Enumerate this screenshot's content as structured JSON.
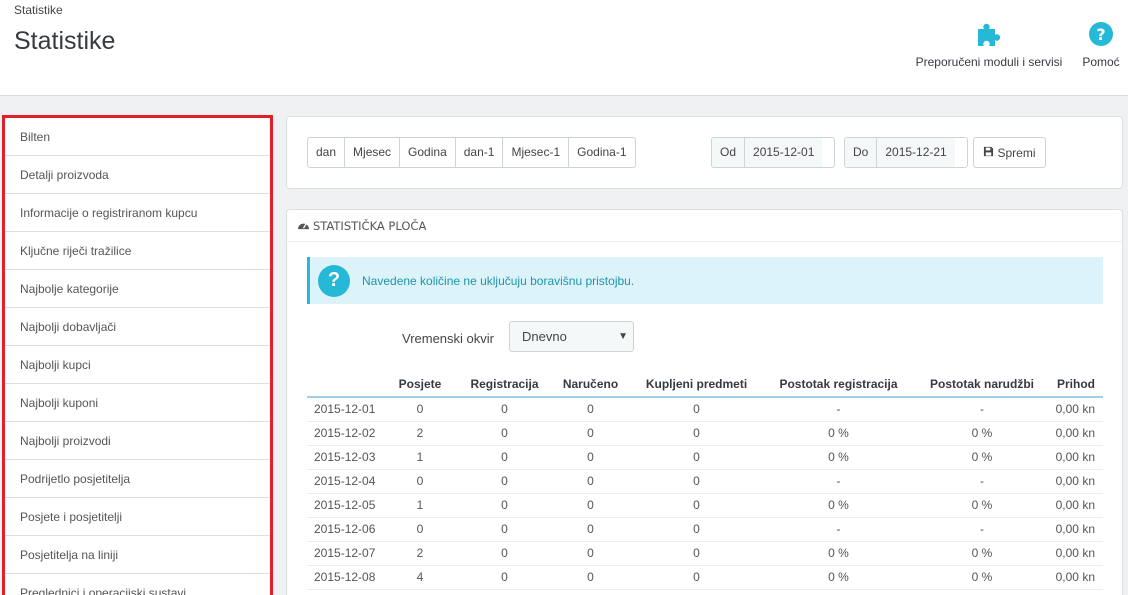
{
  "header": {
    "breadcrumb": "Statistike",
    "title": "Statistike",
    "modules_label": "Preporučeni moduli i servisi",
    "help_label": "Pomoć"
  },
  "sidebar": {
    "items": [
      "Bilten",
      "Detalji proizvoda",
      "Informacije o registriranom kupcu",
      "Ključne riječi tražilice",
      "Najbolje kategorije",
      "Najbolji dobavljači",
      "Najbolji kupci",
      "Najbolji kuponi",
      "Najbolji proizvodi",
      "Podrijetlo posjetitelja",
      "Posjete i posjetitelji",
      "Posjetitelja na liniji",
      "Preglednici i operacijski sustavi"
    ]
  },
  "date_filter": {
    "buttons": [
      "dan",
      "Mjesec",
      "Godina",
      "dan-1",
      "Mjesec-1",
      "Godina-1"
    ],
    "from_label": "Od",
    "from_value": "2015-12-01",
    "to_label": "Do",
    "to_value": "2015-12-21",
    "save_label": "Spremi"
  },
  "dashboard": {
    "heading": "STATISTIČKA PLOČA",
    "alert": "Navedene količine ne uključuju boravišnu pristojbu.",
    "timeframe_label": "Vremenski okvir",
    "timeframe_value": "Dnevno",
    "columns": [
      "",
      "Posjete",
      "Registracija",
      "Naručeno",
      "Kupljeni predmeti",
      "Postotak registracija",
      "Postotak narudžbi",
      "Prihod"
    ],
    "rows": [
      [
        "2015-12-01",
        "0",
        "0",
        "0",
        "0",
        "-",
        "-",
        "0,00 kn"
      ],
      [
        "2015-12-02",
        "2",
        "0",
        "0",
        "0",
        "0 %",
        "0 %",
        "0,00 kn"
      ],
      [
        "2015-12-03",
        "1",
        "0",
        "0",
        "0",
        "0 %",
        "0 %",
        "0,00 kn"
      ],
      [
        "2015-12-04",
        "0",
        "0",
        "0",
        "0",
        "-",
        "-",
        "0,00 kn"
      ],
      [
        "2015-12-05",
        "1",
        "0",
        "0",
        "0",
        "0 %",
        "0 %",
        "0,00 kn"
      ],
      [
        "2015-12-06",
        "0",
        "0",
        "0",
        "0",
        "-",
        "-",
        "0,00 kn"
      ],
      [
        "2015-12-07",
        "2",
        "0",
        "0",
        "0",
        "0 %",
        "0 %",
        "0,00 kn"
      ],
      [
        "2015-12-08",
        "4",
        "0",
        "0",
        "0",
        "0 %",
        "0 %",
        "0,00 kn"
      ]
    ]
  },
  "colors": {
    "accent": "#25b9d7",
    "sidebar_highlight": "#e2202a",
    "alert_bg": "#dcf4f9"
  },
  "icons": {
    "modules": "puzzle-icon",
    "help": "question-circle-icon",
    "save": "floppy-disk-icon",
    "dashboard": "dashboard-gauge-icon",
    "alert": "question-icon"
  }
}
